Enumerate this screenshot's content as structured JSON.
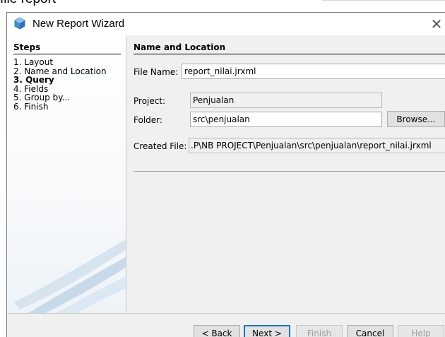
{
  "background": {
    "caption": "file report"
  },
  "window": {
    "title": "New Report Wizard",
    "close_glyph": "✕",
    "icon": "netbeans-cube-icon"
  },
  "steps": {
    "heading": "Steps",
    "current_index": 2,
    "items": [
      {
        "label": "1.  Layout"
      },
      {
        "label": "2.  Name and Location"
      },
      {
        "label": "3.  Query"
      },
      {
        "label": "4.  Fields"
      },
      {
        "label": "5.  Group by..."
      },
      {
        "label": "6.  Finish"
      }
    ]
  },
  "content": {
    "heading": "Name and Location",
    "file_name_label": "File Name:",
    "file_name_value": "report_nilai.jrxml",
    "project_label": "Project:",
    "project_value": "Penjualan",
    "folder_label": "Folder:",
    "folder_value": "src\\penjualan",
    "browse_label": "Browse...",
    "created_file_label": "Created File:",
    "created_file_value": ".P\\NB PROJECT\\Penjualan\\src\\penjualan\\report_nilai.jrxml"
  },
  "buttons": {
    "back": "< Back",
    "next": "Next >",
    "finish": "Finish",
    "cancel": "Cancel",
    "help": "Help"
  },
  "colors": {
    "focus_accent": "#0078d7",
    "dialog_bg": "#f0f0f0",
    "icon_blue": "#3d8fd6"
  }
}
